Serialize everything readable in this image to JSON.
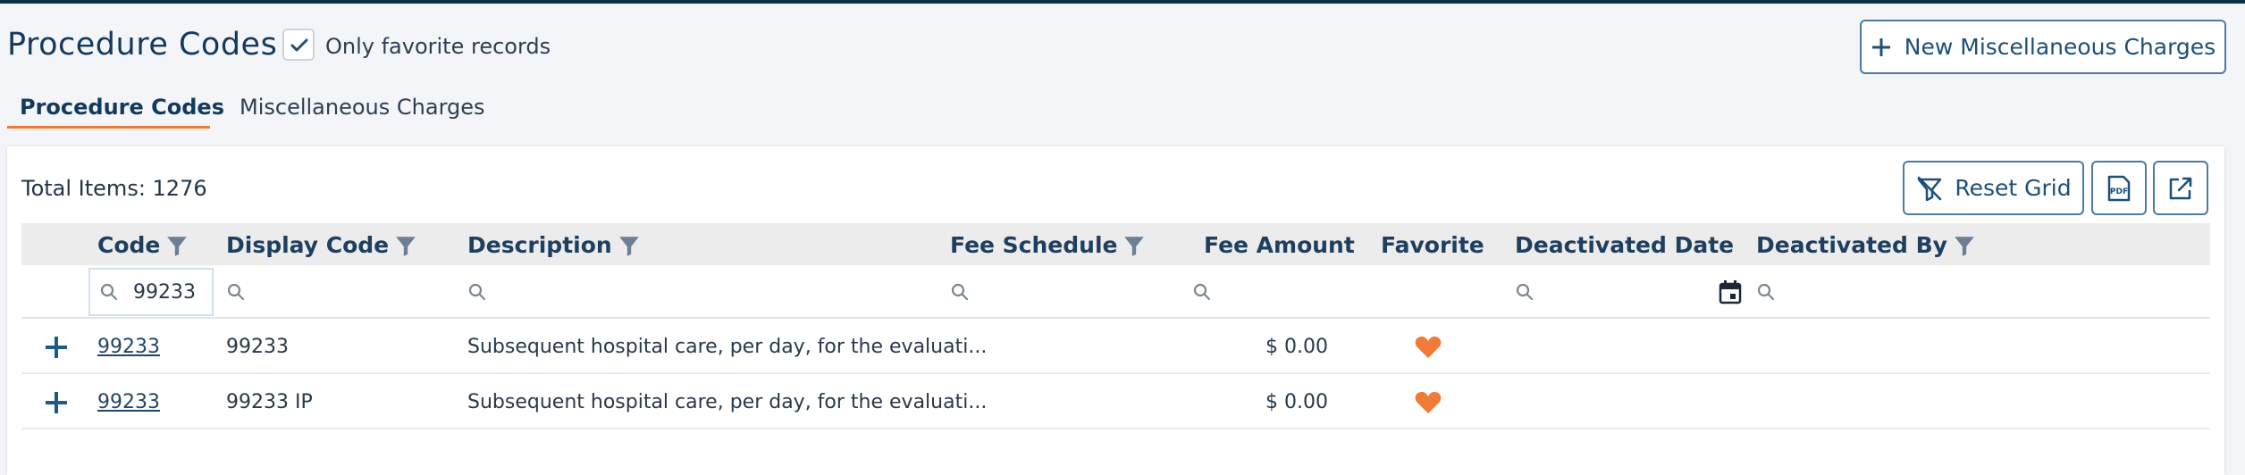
{
  "page": {
    "title": "Procedure Codes",
    "favorite_only_label": "Only favorite records",
    "favorite_only_checked": true,
    "new_button_label": "New Miscellaneous Charges"
  },
  "tabs": [
    {
      "label": "Procedure Codes",
      "active": true
    },
    {
      "label": "Miscellaneous Charges",
      "active": false
    }
  ],
  "toolbar": {
    "total_items": "Total Items: 1276",
    "reset_grid_label": "Reset Grid"
  },
  "grid": {
    "columns": [
      {
        "label": "Code",
        "filterable": true
      },
      {
        "label": "Display Code",
        "filterable": true
      },
      {
        "label": "Description",
        "filterable": true
      },
      {
        "label": "Fee Schedule",
        "filterable": true
      },
      {
        "label": "Fee Amount",
        "filterable": false
      },
      {
        "label": "Favorite",
        "filterable": false
      },
      {
        "label": "Deactivated Date",
        "filterable": false
      },
      {
        "label": "Deactivated By",
        "filterable": true
      }
    ],
    "filters": {
      "code": "99233"
    },
    "rows": [
      {
        "code": "99233",
        "display_code": "99233",
        "description": "Subsequent hospital care, per day, for the evaluati...",
        "fee_amount": "$ 0.00",
        "favorite": true
      },
      {
        "code": "99233",
        "display_code": "99233 IP",
        "description": "Subsequent hospital care, per day, for the evaluati...",
        "fee_amount": "$ 0.00",
        "favorite": true
      }
    ]
  },
  "icons": {
    "checkbox": "check-icon",
    "new": "plus-icon",
    "filter": "funnel-icon",
    "search": "search-icon",
    "calendar": "calendar-icon",
    "expand": "plus-icon",
    "favorite": "heart-icon",
    "reset": "filter-off-icon",
    "pdf": "pdf-icon",
    "export": "export-icon"
  },
  "colors": {
    "accent": "#1c4f79",
    "tab_underline": "#f07a36",
    "favorite_heart": "#f07a36"
  }
}
